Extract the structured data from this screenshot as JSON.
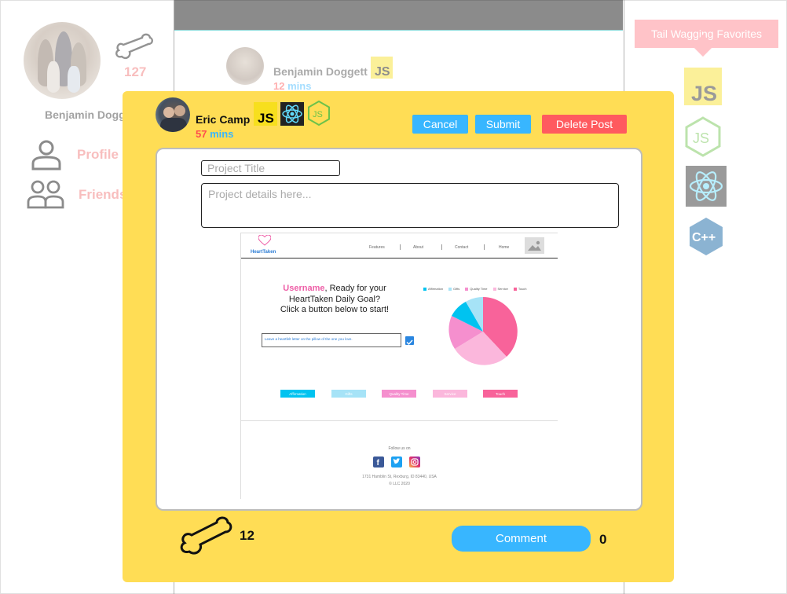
{
  "profile": {
    "name": "Benjamin Dogg",
    "bone_score": "127"
  },
  "sidebar": {
    "items": [
      {
        "label": "Profile",
        "icon": "person-icon"
      },
      {
        "label": "Friends",
        "icon": "people-icon"
      }
    ]
  },
  "feed_post": {
    "author": "Benjamin Doggett",
    "time_value": "12",
    "time_unit": "mins",
    "tags": [
      "js-icon"
    ]
  },
  "favorites": {
    "label": "Tail Wagging Favorites",
    "icons": [
      "js-icon",
      "nodejs-icon",
      "react-icon",
      "cpp-icon"
    ]
  },
  "modal": {
    "author": "Eric Camp",
    "time_value": "57",
    "time_unit": "mins",
    "tags": [
      "js-icon",
      "react-icon",
      "nodejs-icon"
    ],
    "cancel_label": "Cancel",
    "submit_label": "Submit",
    "delete_label": "Delete Post",
    "title_placeholder": "Project Title",
    "details_placeholder": "Project details here...",
    "bone_count": "12",
    "comment_label": "Comment",
    "comment_count": "0"
  },
  "preview": {
    "logo_text": "HeartTaken",
    "nav": [
      "Features",
      "About",
      "Contact",
      "Home"
    ],
    "headline_user": "Username",
    "headline_rest": ", Ready for your",
    "headline_line2": "HeartTaken Daily Goal?",
    "headline_line3": "Click a button below to start!",
    "goal_text": "Leave a heartfelt letter on the pillow of the one you love.",
    "legend": [
      "Affirmation",
      "Gifts",
      "Quality Time",
      "Service",
      "Touch"
    ],
    "categories": [
      "Affirmation",
      "Gifts",
      "Quality Time",
      "Service",
      "Touch"
    ],
    "follow_text": "Follow us on",
    "address": "1731 Hamblin St, Rexburg, ID 83440, USA",
    "copyright": "LLC 2020",
    "colors": {
      "affirmation": "#00c3f0",
      "gifts": "#a6e3f7",
      "quality_time": "#f58fce",
      "service": "#fbb7dc",
      "touch": "#f8639a"
    }
  },
  "colors": {
    "accent_yellow": "#ffdd55",
    "button_blue": "#38b6ff",
    "button_red": "#ff5a5f",
    "time_value": "#ff4d4d",
    "time_unit": "#38b6ff",
    "favorite_pink": "#ff7b86"
  }
}
